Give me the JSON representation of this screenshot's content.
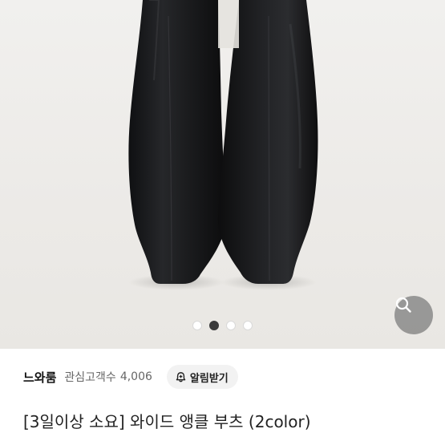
{
  "carousel": {
    "image": "black-leather-square-toe-ankle-boots-photo",
    "page_count": 4,
    "active_index": 1
  },
  "search_button": {
    "icon": "search-icon"
  },
  "seller": {
    "name": "느와룸",
    "fans_label": "관심고객수",
    "fans_count": "4,006",
    "alarm_label": "알림받기",
    "alarm_icon": "bell-plus-icon"
  },
  "product": {
    "title": "[3일이상 소요] 와이드 앵클 부츠 (2color)"
  }
}
